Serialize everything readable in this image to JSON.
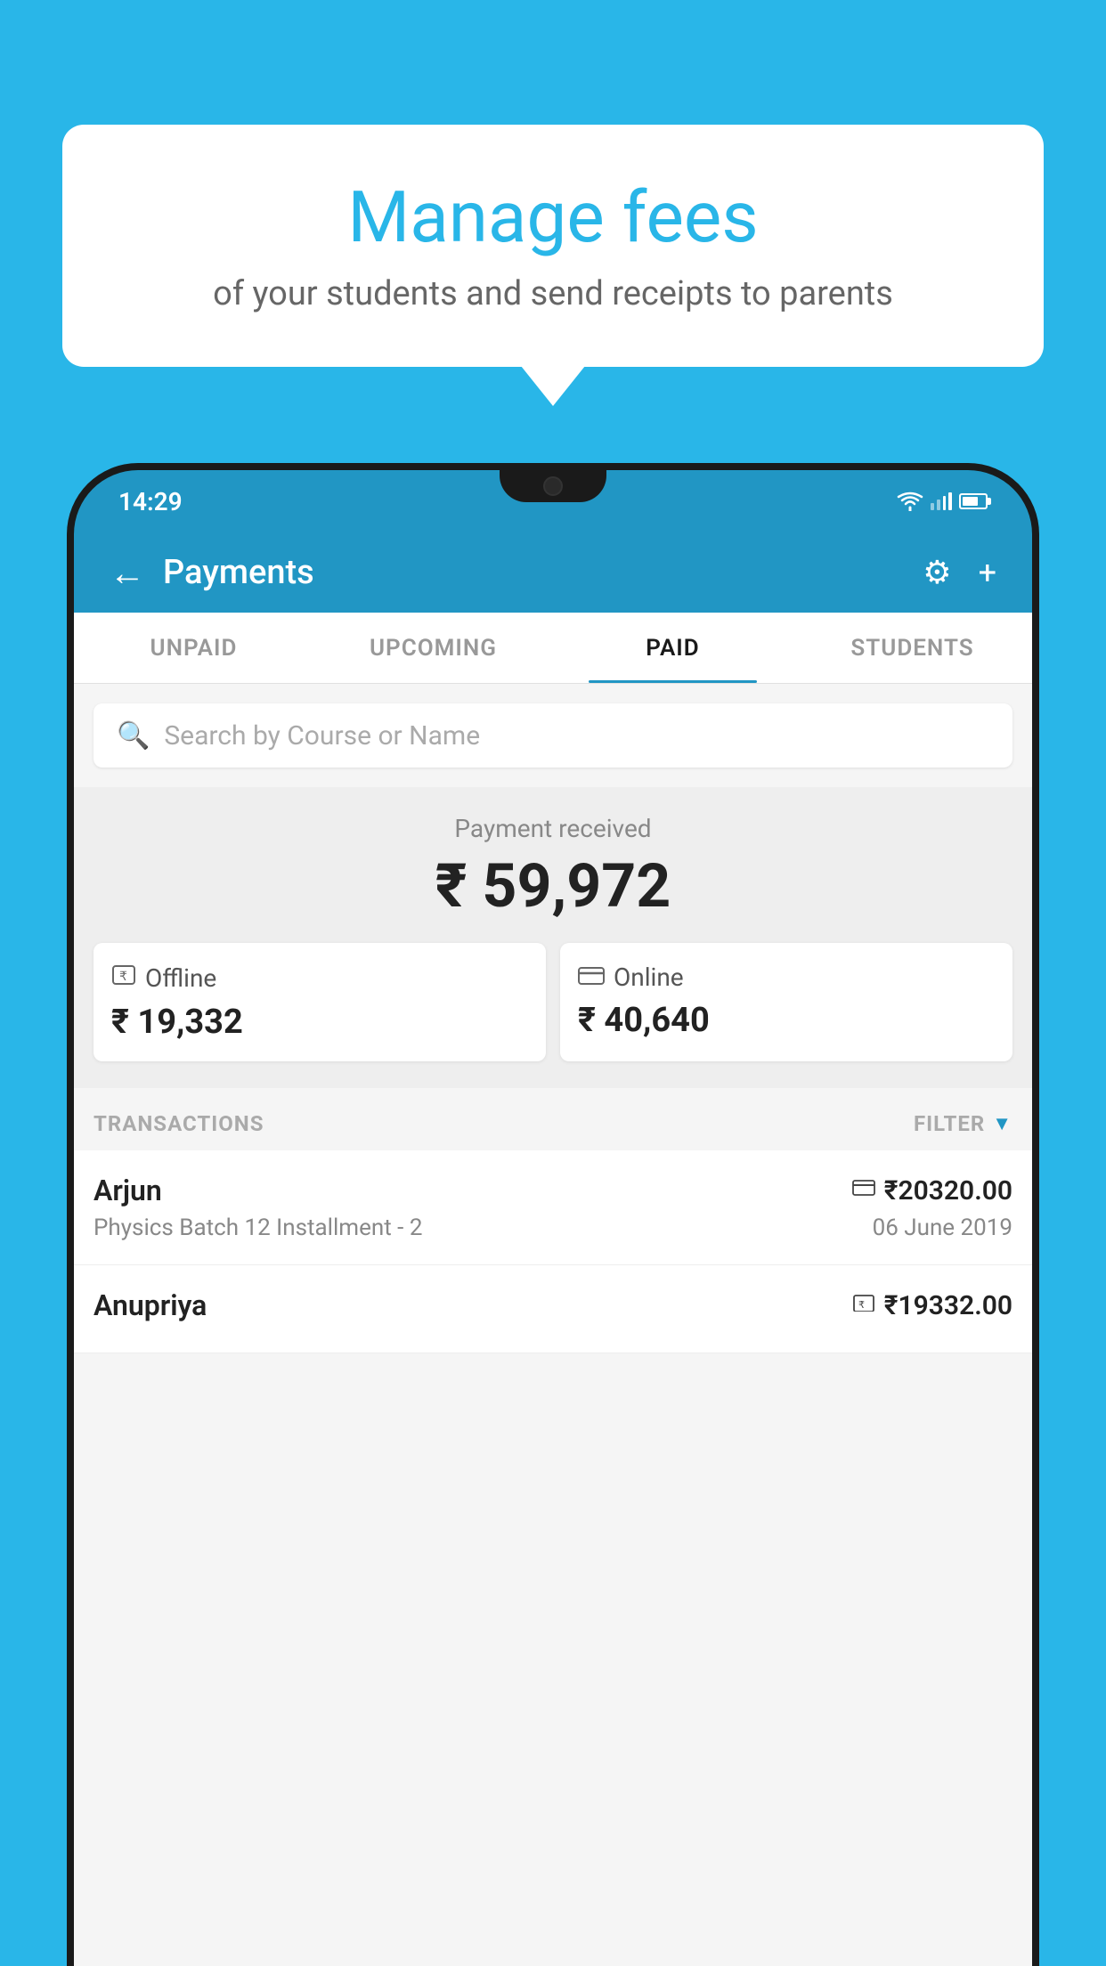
{
  "background_color": "#29b6e8",
  "bubble": {
    "title": "Manage fees",
    "subtitle": "of your students and send receipts to parents"
  },
  "status_bar": {
    "time": "14:29"
  },
  "header": {
    "title": "Payments",
    "back_label": "←",
    "gear_label": "⚙",
    "plus_label": "+"
  },
  "tabs": [
    {
      "label": "UNPAID",
      "active": false
    },
    {
      "label": "UPCOMING",
      "active": false
    },
    {
      "label": "PAID",
      "active": true
    },
    {
      "label": "STUDENTS",
      "active": false
    }
  ],
  "search": {
    "placeholder": "Search by Course or Name"
  },
  "payment_summary": {
    "label": "Payment received",
    "amount": "₹ 59,972",
    "offline_label": "Offline",
    "offline_amount": "₹ 19,332",
    "online_label": "Online",
    "online_amount": "₹ 40,640"
  },
  "transactions": {
    "header_label": "TRANSACTIONS",
    "filter_label": "FILTER",
    "rows": [
      {
        "name": "Arjun",
        "course": "Physics Batch 12 Installment - 2",
        "amount": "₹20320.00",
        "date": "06 June 2019",
        "payment_type": "online"
      },
      {
        "name": "Anupriya",
        "course": "",
        "amount": "₹19332.00",
        "date": "",
        "payment_type": "offline"
      }
    ]
  }
}
